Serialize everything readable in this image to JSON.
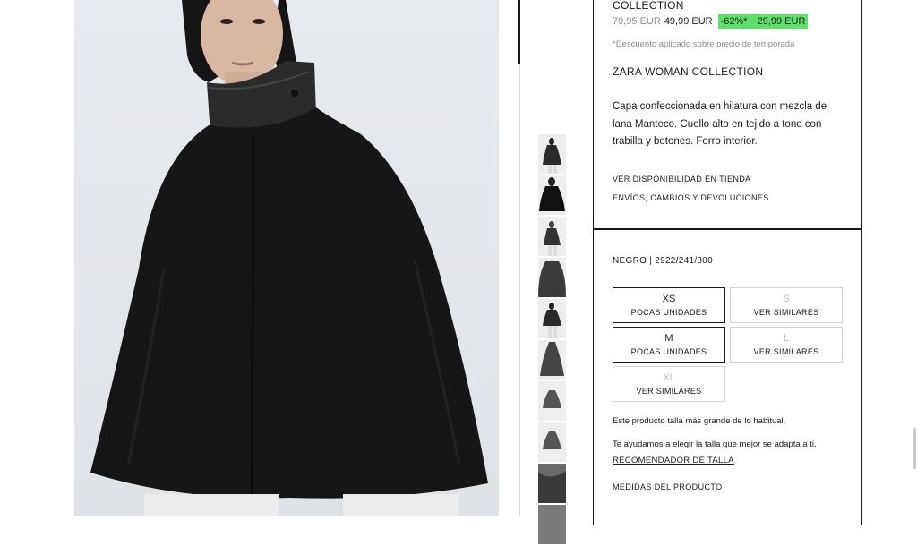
{
  "product": {
    "collection_top": "COLLECTION",
    "price_original": "79,95 EUR",
    "price_previous": "49,99 EUR",
    "discount": "-62%*",
    "price_current": "29,99 EUR",
    "discount_note": "*Descuento aplicado sobre precio de temporada",
    "collection_name": "ZARA WOMAN COLLECTION",
    "description": "Capa confeccionada en hilatura con mezcla de lana Manteco. Cuello alto en tejido a tono con trabilla y botones. Forro interior.",
    "store_availability_label": "VER DISPONIBILIDAD EN TIENDA",
    "shipping_label": "ENVÍOS, CAMBIOS Y DEVOLUCIONES"
  },
  "variant": {
    "color_ref": "NEGRO | 2922/241/800"
  },
  "sizes": [
    {
      "size": "XS",
      "status": "POCAS UNIDADES",
      "available": true
    },
    {
      "size": "S",
      "status": "VER SIMILARES",
      "available": false
    },
    {
      "size": "M",
      "status": "POCAS UNIDADES",
      "available": true
    },
    {
      "size": "L",
      "status": "VER SIMILARES",
      "available": false
    },
    {
      "size": "XL",
      "status": "VER SIMILARES",
      "available": false
    }
  ],
  "size_help": {
    "fit_note": "Este producto talla más grande de lo habitual.",
    "help_note": "Te ayudamos a elegir la talla que mejor se adapta a ti.",
    "recommender_label": "RECOMENDADOR DE TALLA",
    "measures_label": "MEDIDAS DEL PRODUCTO"
  },
  "colors": {
    "discount_bg": "#5fe06a",
    "border": "#1a1a1a",
    "muted_text": "#8a8a8a"
  },
  "icons": [
    "product-photo",
    "thumbnail"
  ]
}
